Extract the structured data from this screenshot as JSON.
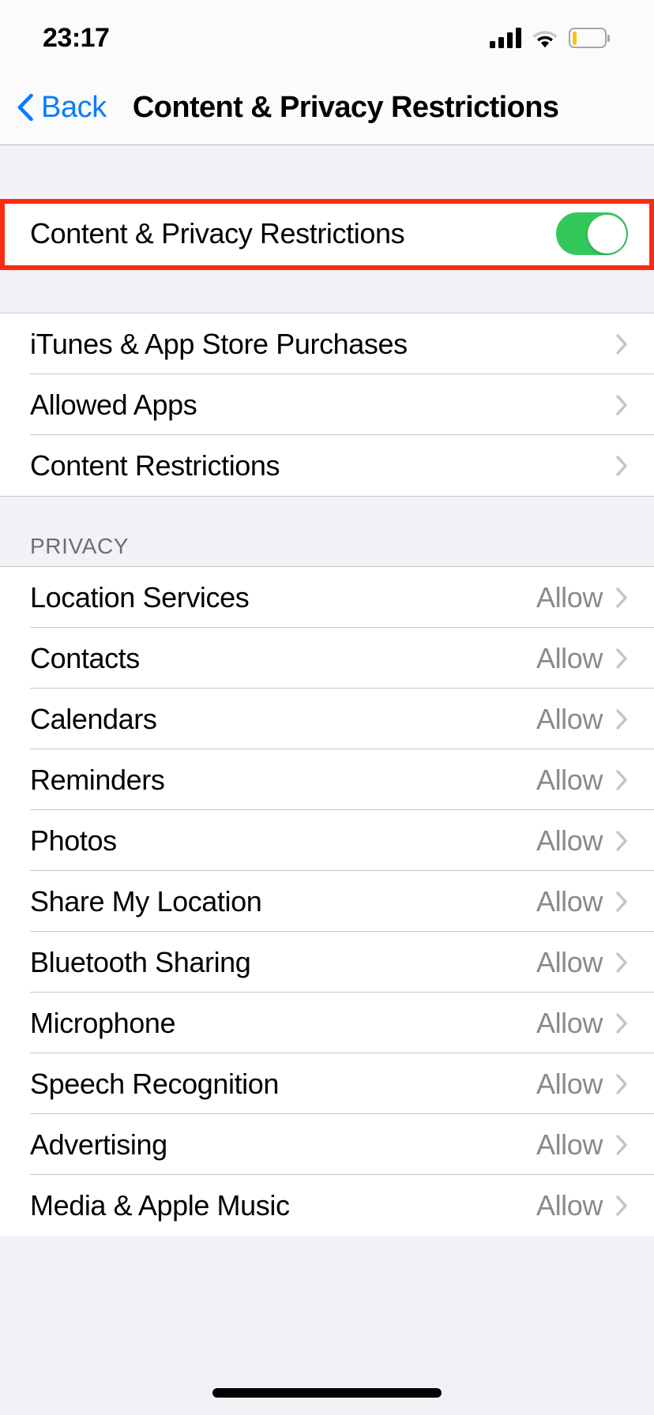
{
  "status_bar": {
    "time": "23:17",
    "signal_icon": "cellular-signal-icon",
    "signal_bars": 4,
    "wifi_icon": "wifi-icon",
    "battery_icon": "battery-icon",
    "battery_level_percent": 12,
    "battery_fill_color": "#F9C31B"
  },
  "nav_bar": {
    "back_label": "Back",
    "back_icon": "chevron-left-icon",
    "title": "Content & Privacy Restrictions",
    "back_color": "#0A7BFF"
  },
  "highlight": {
    "color": "#F92B10",
    "target": "content-privacy-restrictions-toggle-row"
  },
  "toggle_section": {
    "label": "Content & Privacy Restrictions",
    "toggle_state": "on",
    "toggle_color": "#34C759"
  },
  "restrictions_group": {
    "rows": [
      {
        "label": "iTunes & App Store Purchases",
        "value": "",
        "chevron": "chevron-right-icon"
      },
      {
        "label": "Allowed Apps",
        "value": "",
        "chevron": "chevron-right-icon"
      },
      {
        "label": "Content Restrictions",
        "value": "",
        "chevron": "chevron-right-icon"
      }
    ]
  },
  "privacy_section": {
    "header": "PRIVACY",
    "rows": [
      {
        "label": "Location Services",
        "value": "Allow",
        "chevron": "chevron-right-icon"
      },
      {
        "label": "Contacts",
        "value": "Allow",
        "chevron": "chevron-right-icon"
      },
      {
        "label": "Calendars",
        "value": "Allow",
        "chevron": "chevron-right-icon"
      },
      {
        "label": "Reminders",
        "value": "Allow",
        "chevron": "chevron-right-icon"
      },
      {
        "label": "Photos",
        "value": "Allow",
        "chevron": "chevron-right-icon"
      },
      {
        "label": "Share My Location",
        "value": "Allow",
        "chevron": "chevron-right-icon"
      },
      {
        "label": "Bluetooth Sharing",
        "value": "Allow",
        "chevron": "chevron-right-icon"
      },
      {
        "label": "Microphone",
        "value": "Allow",
        "chevron": "chevron-right-icon"
      },
      {
        "label": "Speech Recognition",
        "value": "Allow",
        "chevron": "chevron-right-icon"
      },
      {
        "label": "Advertising",
        "value": "Allow",
        "chevron": "chevron-right-icon"
      },
      {
        "label": "Media & Apple Music",
        "value": "Allow",
        "chevron": "chevron-right-icon"
      }
    ]
  },
  "home_indicator": {
    "name": "home-indicator"
  }
}
